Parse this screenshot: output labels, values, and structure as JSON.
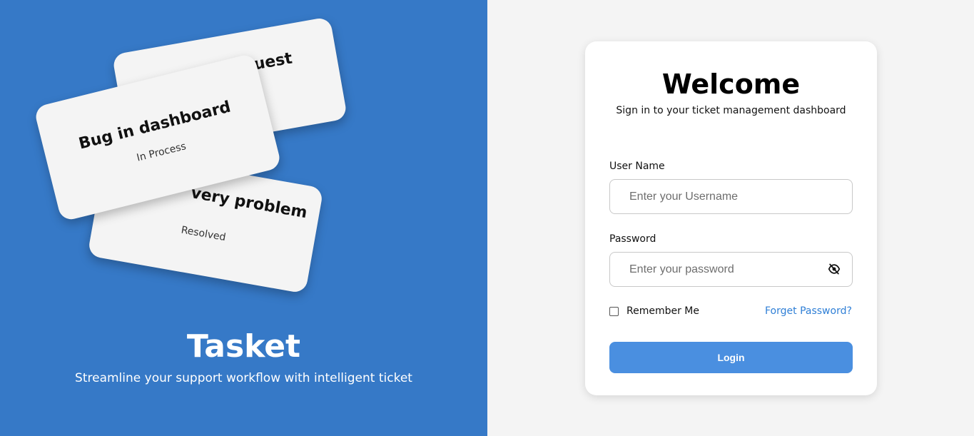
{
  "brand": {
    "name": "Tasket",
    "tagline": "Streamline your support workflow with intelligent ticket"
  },
  "tickets": [
    {
      "title": "quest",
      "status": ""
    },
    {
      "title": "very problem",
      "status": "Resolved"
    },
    {
      "title": "Bug in dashboard",
      "status": "In Process"
    }
  ],
  "login": {
    "title": "Welcome",
    "subtitle": "Sign in to your ticket management dashboard",
    "username_label": "User Name",
    "username_placeholder": "Enter your Username",
    "username_value": "",
    "password_label": "Password",
    "password_placeholder": "Enter your password",
    "password_value": "",
    "password_toggle_icon": "eye-off-icon",
    "remember_label": "Remember Me",
    "remember_checked": false,
    "forgot_label": "Forget Password?",
    "submit_label": "Login"
  },
  "colors": {
    "brand_panel": "#3679c7",
    "button": "#4a8fe0",
    "link": "#2f7fd6",
    "background": "#f4f4f4"
  }
}
